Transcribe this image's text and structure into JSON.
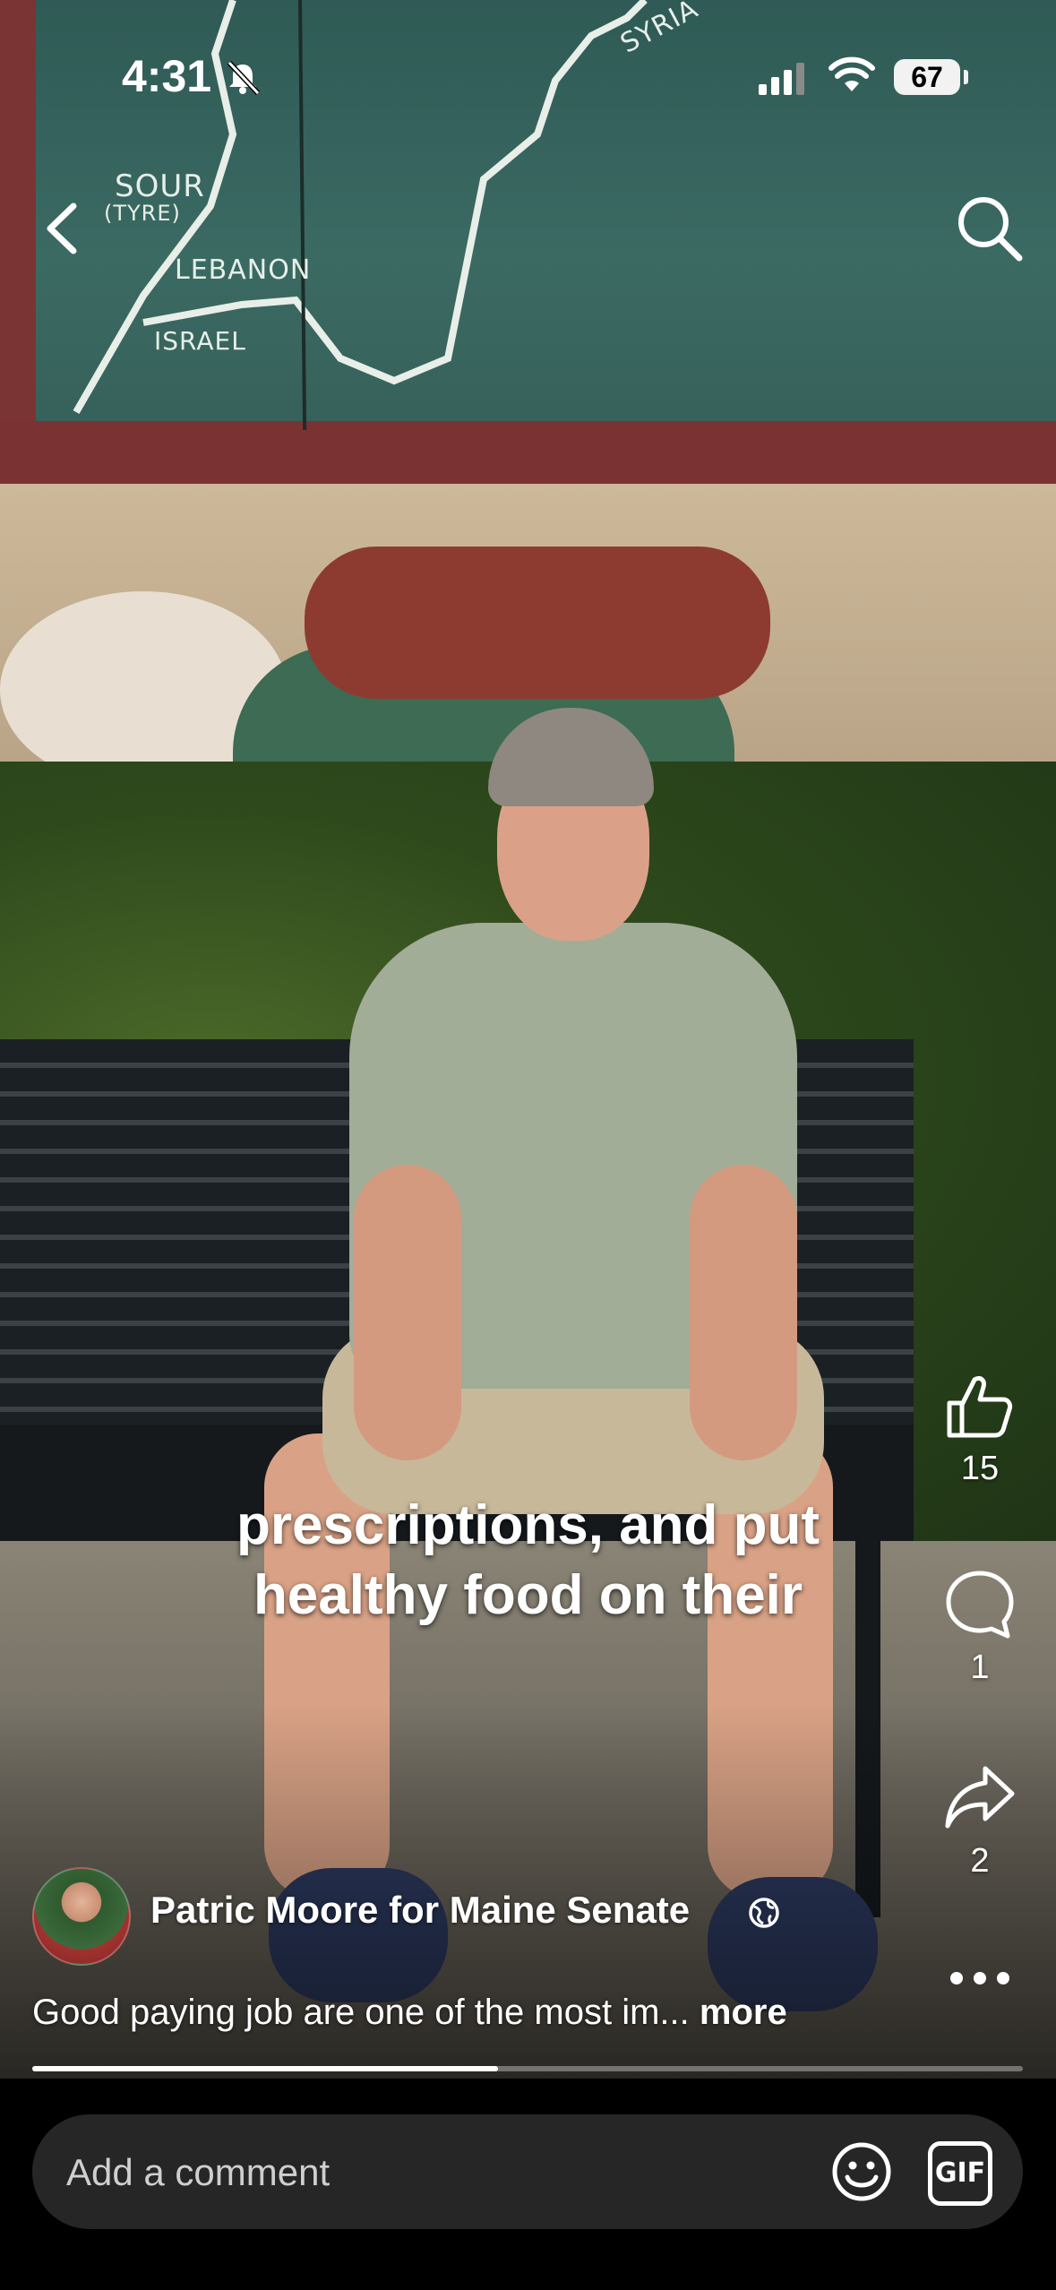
{
  "status_bar": {
    "time": "4:31",
    "battery": "67",
    "icons": [
      "bell-slash-icon",
      "signal-icon",
      "wifi-icon",
      "battery-icon"
    ]
  },
  "top_bar": {
    "icons": [
      "back-icon",
      "search-icon"
    ]
  },
  "video": {
    "mural_labels": [
      "SYRIA",
      "SOUR",
      "(TYRE)",
      "LEBANON",
      "ISRAEL"
    ],
    "caption_lines": [
      "prescriptions, and put",
      "healthy food on their"
    ],
    "progress": 0.47
  },
  "actions": {
    "like_count": "15",
    "comment_count": "1",
    "share_count": "2",
    "icons": [
      "thumbs-up-icon",
      "comment-icon",
      "share-icon",
      "more-icon"
    ]
  },
  "post": {
    "author": "Patric Moore for Maine Senate",
    "description": "Good paying job are one of the most im...",
    "more_label": "more",
    "audience_icon": "globe-icon"
  },
  "comment_bar": {
    "placeholder": "Add a comment",
    "gif_label": "GIF",
    "icons": [
      "emoji-icon",
      "gif-icon"
    ]
  }
}
